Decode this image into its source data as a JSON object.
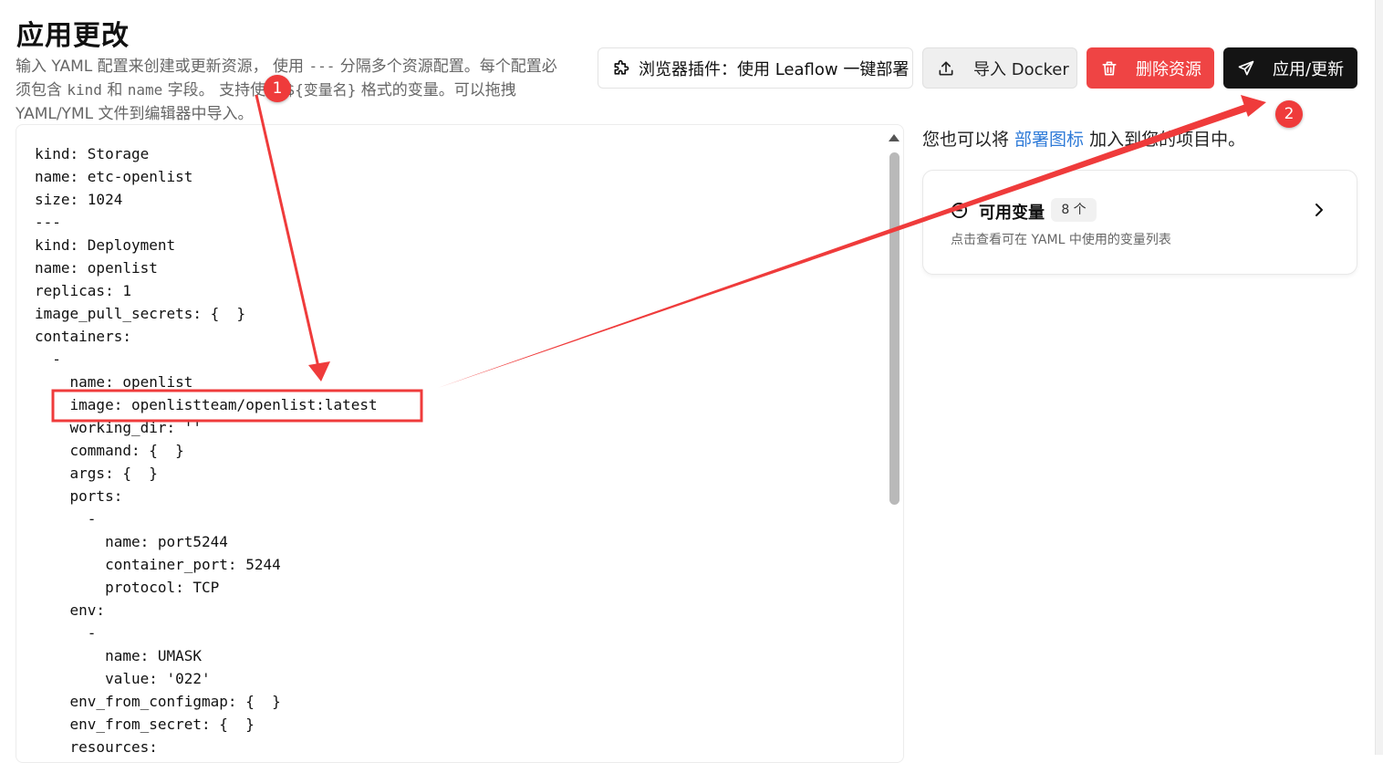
{
  "header": {
    "title": "应用更改",
    "description": {
      "part1": "输入 YAML 配置来创建或更新资源， 使用 ",
      "sep_code": "---",
      "part2": " 分隔多个资源配置。每个配置必",
      "part3": "须包含 ",
      "kind_code": "kind",
      "part4": " 和 ",
      "name_code": "name",
      "part5": " 字段。 支持使用 ",
      "var_code": "${变量名}",
      "part6": " 格式的变量。可以拖拽",
      "part7": "YAML/YML 文件到编辑器中导入。"
    }
  },
  "toolbar": {
    "plugin_label": "浏览器插件：使用 Leaflow 一键部署",
    "plugin_icon": "puzzle-icon",
    "docker_label": "导入 Docker",
    "docker_icon": "upload-icon",
    "delete_label": "删除资源",
    "delete_icon": "trash-icon",
    "apply_label": "应用/更新",
    "apply_icon": "send-icon"
  },
  "editor": {
    "lines": [
      "kind: Storage",
      "name: etc-openlist",
      "size: 1024",
      "---",
      "kind: Deployment",
      "name: openlist",
      "replicas: 1",
      "image_pull_secrets: {  }",
      "containers:",
      "  -",
      "    name: openlist",
      "    image: openlistteam/openlist:latest",
      "    working_dir: ''",
      "    command: {  }",
      "    args: {  }",
      "    ports:",
      "      -",
      "        name: port5244",
      "        container_port: 5244",
      "        protocol: TCP",
      "    env:",
      "      -",
      "        name: UMASK",
      "        value: '022'",
      "    env_from_configmap: {  }",
      "    env_from_secret: {  }",
      "    resources:"
    ]
  },
  "side": {
    "hint_prefix": "您也可以将 ",
    "hint_link": "部署图标",
    "hint_suffix": " 加入到您的项目中。",
    "variables": {
      "title": "可用变量",
      "count": "8 个",
      "subtitle": "点击查看可在 YAML 中使用的变量列表",
      "icon": "info-circle-icon",
      "chevron": "chevron-right-icon"
    }
  },
  "annotations": {
    "marker1": "1",
    "marker2": "2",
    "color": "#ef3b3b"
  }
}
